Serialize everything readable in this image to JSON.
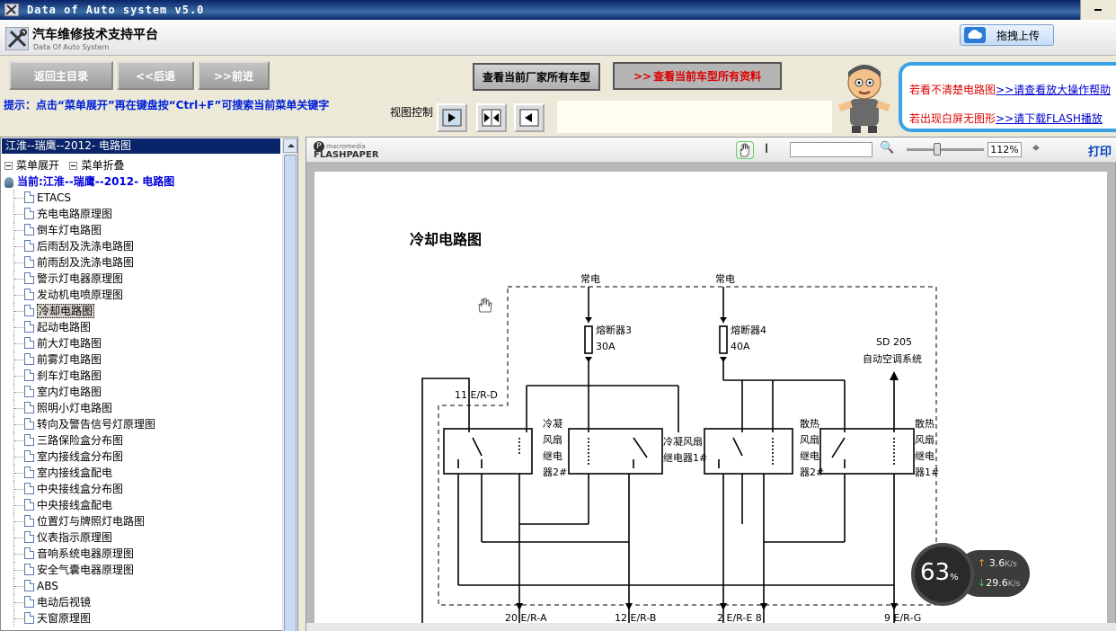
{
  "window": {
    "title": "Data of Auto system v5.0"
  },
  "header": {
    "app_name": "汽车维修技术支持平台",
    "app_subtitle": "Data Of Auto System",
    "upload_label": "拖拽上传"
  },
  "nav": {
    "main_menu": "返回主目录",
    "back": "<<后退",
    "forward": ">>前进",
    "vendor_models": "查看当前厂家所有车型",
    "model_docs": "查看当前车型所有资料",
    "model_docs_arrow": ">>"
  },
  "help": {
    "line1_text": "若看不清楚电路图",
    "line1_link": ">>请查看放大操作帮助",
    "line2_text": "若出现白屏无图形",
    "line2_link": ">>请下载FLASH播放"
  },
  "tip": "提示：点击“菜单展开”再在键盘按“Ctrl+F”可搜索当前菜单关键字",
  "view_control": {
    "label": "视图控制"
  },
  "sidebar": {
    "selected_header": "江淮--瑞鹰--2012- 电路图",
    "expand": "菜单展开",
    "collapse": "菜单折叠",
    "current": "当前:江淮--瑞鹰--2012- 电路图",
    "items": [
      "ETACS",
      "充电电路原理图",
      "倒车灯电路图",
      "后雨刮及洗涤电路图",
      "前雨刮及洗涤电路图",
      "警示灯电器原理图",
      "发动机电喷原理图",
      "冷却电路图",
      "起动电路图",
      "前大灯电路图",
      "前雾灯电路图",
      "刹车灯电路图",
      "室内灯电路图",
      "照明小灯电路图",
      "转向及警告信号灯原理图",
      "三路保险盒分布图",
      "室内接线盒分布图",
      "室内接线盒配电",
      "中央接线盒分布图",
      "中央接线盒配电",
      "位置灯与牌照灯电路图",
      "仪表指示原理图",
      "音响系统电器原理图",
      "安全气囊电器原理图",
      "ABS",
      "电动后视镜",
      "天窗原理图"
    ],
    "selected_index": 7
  },
  "viewer": {
    "brand_top": "macromedia",
    "brand": "FLASHPAPER",
    "zoom": "112%",
    "print": "打印",
    "page_title": "冷却电路图"
  },
  "diagram": {
    "power_left": "常电",
    "power_right": "常电",
    "fuse3": "熔断器3",
    "fuse3_amp": "30A",
    "fuse4": "熔断器4",
    "fuse4_amp": "40A",
    "ac_code": "SD 205",
    "ac_label": "自动空调系统",
    "conn_top": "11 E/R-D",
    "relay_a": [
      "冷凝",
      "风扇",
      "继电",
      "器2#"
    ],
    "relay_b": [
      "冷凝风扇",
      "继电器1#"
    ],
    "relay_c": [
      "散热",
      "风扇",
      "继电",
      "器2#"
    ],
    "relay_d": [
      "散热",
      "风扇",
      "继电",
      "器1#"
    ],
    "bottom": [
      "20 E/R-A",
      "12 E/R-B",
      "2 E/R-E 8",
      "9 E/R-G"
    ]
  },
  "netmeter": {
    "percent": "63",
    "percent_unit": "%",
    "up": "3.6",
    "down": "29.6",
    "unit": "K/s"
  }
}
